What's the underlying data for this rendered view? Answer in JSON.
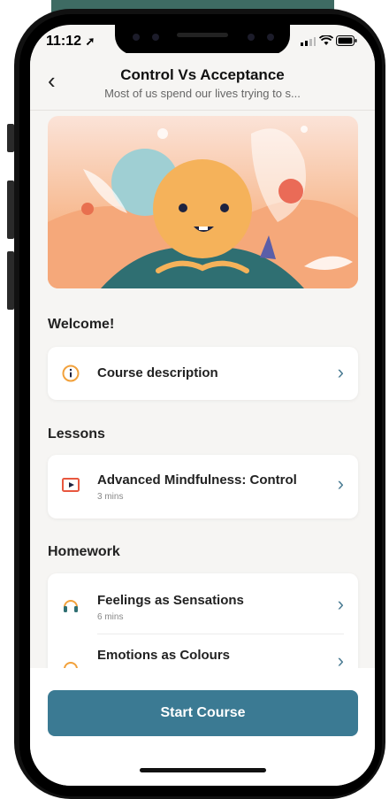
{
  "status_bar": {
    "time": "11:12",
    "location_icon": "location-arrow-icon",
    "signal_icon": "signal-icon",
    "wifi_icon": "wifi-icon",
    "battery_icon": "battery-icon"
  },
  "header": {
    "title": "Control Vs Acceptance",
    "subtitle": "Most of us spend our lives trying to s...",
    "back_icon": "chevron-left-icon"
  },
  "welcome": {
    "heading": "Welcome!",
    "items": [
      {
        "label": "Course description",
        "icon": "info-icon"
      }
    ]
  },
  "lessons": {
    "heading": "Lessons",
    "items": [
      {
        "label": "Advanced Mindfulness: Control",
        "meta": "3 mins",
        "icon": "video-icon"
      }
    ]
  },
  "homework": {
    "heading": "Homework",
    "items": [
      {
        "label": "Feelings as Sensations",
        "meta": "6 mins",
        "icon": "headphones-icon"
      },
      {
        "label": "Emotions as Colours",
        "meta": "",
        "icon": "headphones-icon"
      }
    ]
  },
  "cta": {
    "label": "Start Course"
  },
  "colors": {
    "accent": "#3b7a93",
    "icon_orange": "#f2a13b",
    "chevron": "#4c7d94",
    "background": "#f6f5f3",
    "top_band": "#3e6b63"
  }
}
